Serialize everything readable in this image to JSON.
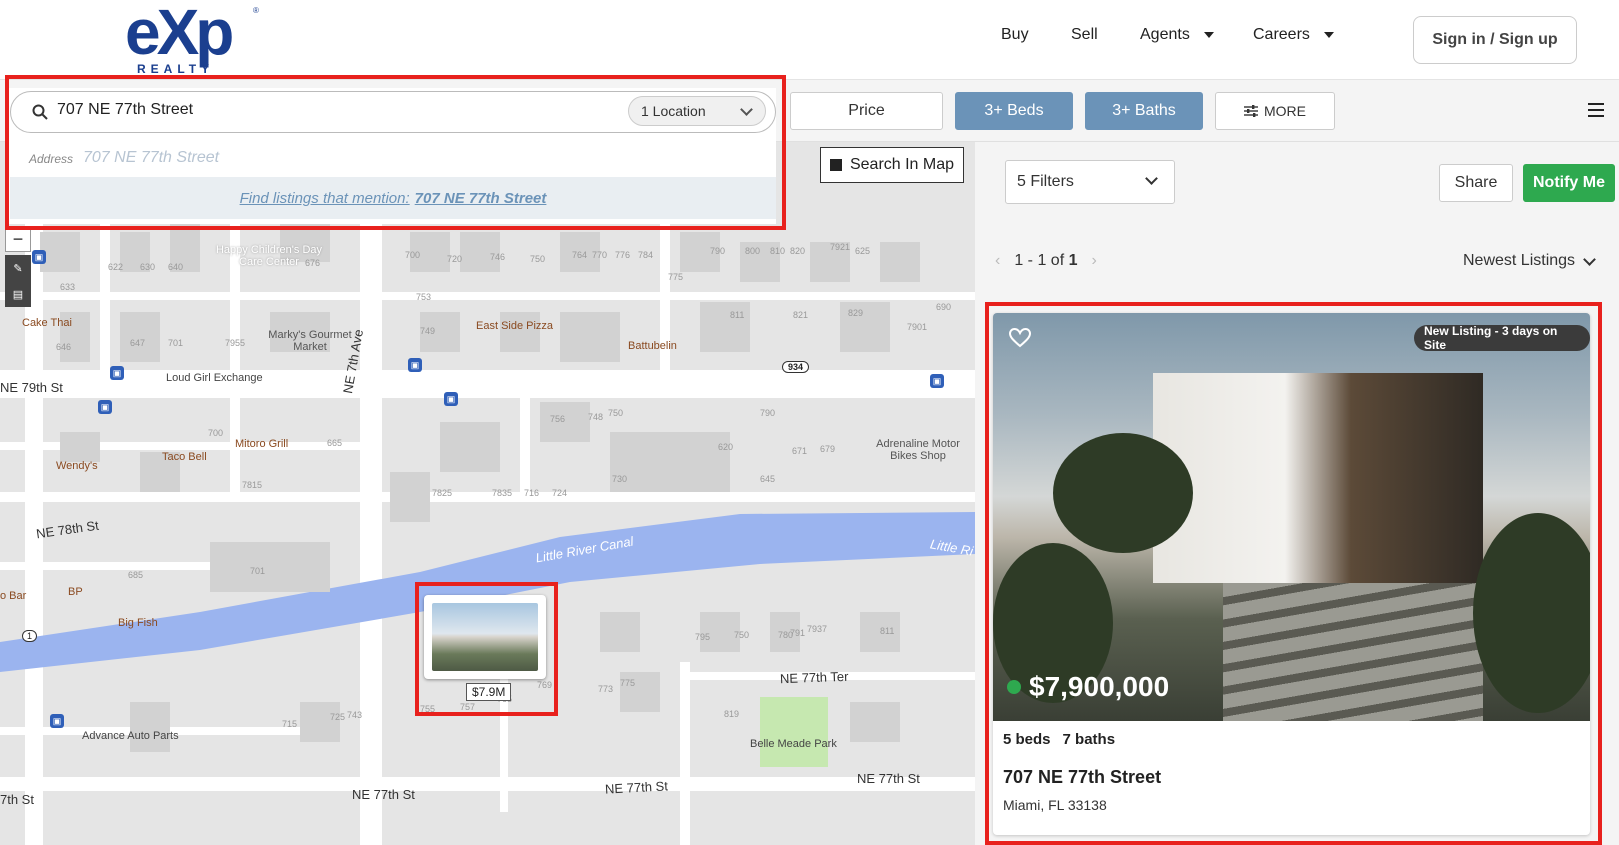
{
  "header": {
    "logo": {
      "wordmark": "eXp",
      "sub": "REALTY",
      "reg": "®"
    },
    "nav": {
      "buy": "Buy",
      "sell": "Sell",
      "agents": "Agents",
      "careers": "Careers"
    },
    "signin": "Sign in / Sign up"
  },
  "filterbar": {
    "price": "Price",
    "beds": "3+ Beds",
    "baths": "3+ Baths",
    "more": "MORE"
  },
  "search": {
    "value": "707 NE 77th Street",
    "location_select": "1 Location",
    "suggestion_label": "Address",
    "suggestion_value": "707 NE 77th Street",
    "mention_prefix": "Find listings that mention:",
    "mention_value": "707 NE 77th Street"
  },
  "map": {
    "search_in_map": "Search In Map",
    "zoom_out": "−",
    "pin_price": "$7.9M",
    "streets": {
      "ne79": "NE 79th St",
      "ne78": "NE 78th St",
      "ne77ter": "NE 77th Ter",
      "ne77a": "NE 77th St",
      "ne77b": "NE 77th St",
      "ne77c": "NE 77th St",
      "ne77d": "7th St",
      "ne7ave": "NE 7th Ave",
      "canal": "Little River Canal",
      "canal2": "Little Ri",
      "route": "934",
      "route2": "1"
    },
    "pois": {
      "happy": "Happy Children's Day Care Center",
      "cake": "Cake Thai",
      "markys": "Marky's Gourmet Market",
      "eastside": "East Side Pizza",
      "battubelin": "Battubelin",
      "loudgirl": "Loud Girl Exchange",
      "wendys": "Wendy's",
      "tacobell": "Taco Bell",
      "mitoro": "Mitoro Grill",
      "adrenaline": "Adrenaline Motor Bikes Shop",
      "bp": "BP",
      "bigfish": "Big Fish",
      "advance": "Advance Auto Parts",
      "belle": "Belle Meade Park",
      "bar": "o Bar"
    },
    "house_numbers": [
      "622",
      "630",
      "640",
      "676",
      "700",
      "720",
      "746",
      "750",
      "764",
      "770",
      "776",
      "784",
      "790",
      "800",
      "810",
      "820",
      "7921",
      "625",
      "633",
      "647",
      "701",
      "7955",
      "749",
      "753",
      "775",
      "811",
      "821",
      "829",
      "7901",
      "690",
      "646",
      "665",
      "700",
      "7815",
      "7825",
      "7835",
      "716",
      "724",
      "730",
      "756",
      "748",
      "750",
      "790",
      "620",
      "645",
      "671",
      "679",
      "685",
      "701",
      "715",
      "725",
      "743",
      "755",
      "757",
      "765",
      "769",
      "773",
      "775",
      "795",
      "750",
      "780",
      "791",
      "7937",
      "811",
      "819"
    ]
  },
  "results": {
    "filters_select": "5 Filters",
    "share": "Share",
    "notify": "Notify Me",
    "pager": {
      "range": "1 - 1 of ",
      "total": "1"
    },
    "sort": "Newest Listings",
    "listing": {
      "badge": "New Listing - 3 days on Site",
      "price": "$7,900,000",
      "beds": "5 beds",
      "baths": "7 baths",
      "address": "707 NE 77th Street",
      "city": "Miami, FL 33138"
    }
  },
  "colors": {
    "brand": "#1b3f8f",
    "accent_filter": "#6b93b8",
    "notify": "#2ea94f",
    "highlight": "#e8211d",
    "canal": "#9bb4ef"
  },
  "icons": {
    "search": "search-icon",
    "heart": "heart-icon",
    "chevron": "chevron-down-icon",
    "hamburger": "menu-icon",
    "sliders": "sliders-icon",
    "bus": "bus-icon"
  }
}
